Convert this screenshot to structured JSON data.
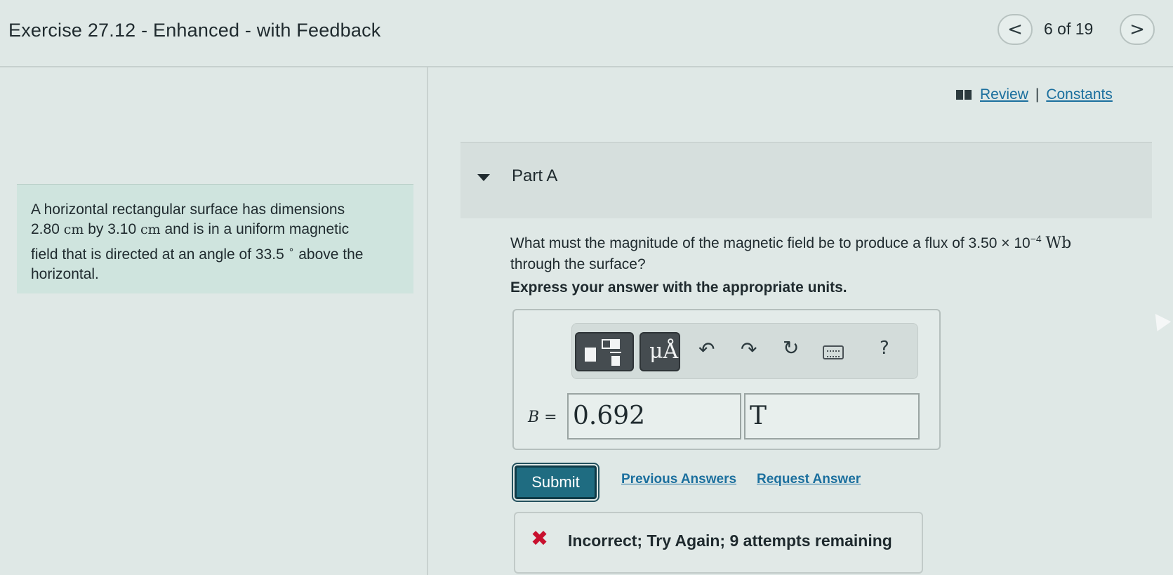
{
  "header": {
    "title": "Exercise 27.12 - Enhanced - with Feedback",
    "pager": "6 of 19",
    "prev_symbol": "<",
    "next_symbol": ">"
  },
  "problem": {
    "line1": "A horizontal rectangular surface has dimensions",
    "dim1": "2.80",
    "unit_cm": "cm",
    "by": "by",
    "dim2": "3.10",
    "line2_tail": "and is in a uniform magnetic",
    "line3_pre": "field that is directed at an angle of",
    "angle": "33.5",
    "degree": "∘",
    "line3_post": "above the",
    "line4": "horizontal."
  },
  "links": {
    "review": "Review",
    "separator": "|",
    "constants": "Constants"
  },
  "part": {
    "title": "Part A",
    "question_pre": "What must the magnitude of the magnetic field be to produce a flux of 3.50",
    "times": "×",
    "ten": "10",
    "exponent": "−4",
    "unit_wb": "Wb",
    "question_post": "through the surface?",
    "express": "Express your answer with the appropriate units."
  },
  "toolbar": {
    "units_label": "μÅ",
    "undo_icon": "undo-icon",
    "redo_icon": "redo-icon",
    "reset_icon": "reset-icon",
    "keyboard_icon": "keyboard-icon",
    "help": "?"
  },
  "answer": {
    "variable": "B",
    "equals": "=",
    "value": "0.692",
    "unit": "T"
  },
  "actions": {
    "submit": "Submit",
    "previous_answers": "Previous Answers",
    "request_answer": "Request Answer"
  },
  "feedback": {
    "icon": "✖",
    "text": "Incorrect; Try Again; 9 attempts remaining"
  },
  "colors": {
    "page_bg": "#dfe8e6",
    "accent_submit": "#1f6c81",
    "link": "#1b6f9e",
    "error": "#c8102e",
    "problem_bg": "#cfe4de"
  }
}
